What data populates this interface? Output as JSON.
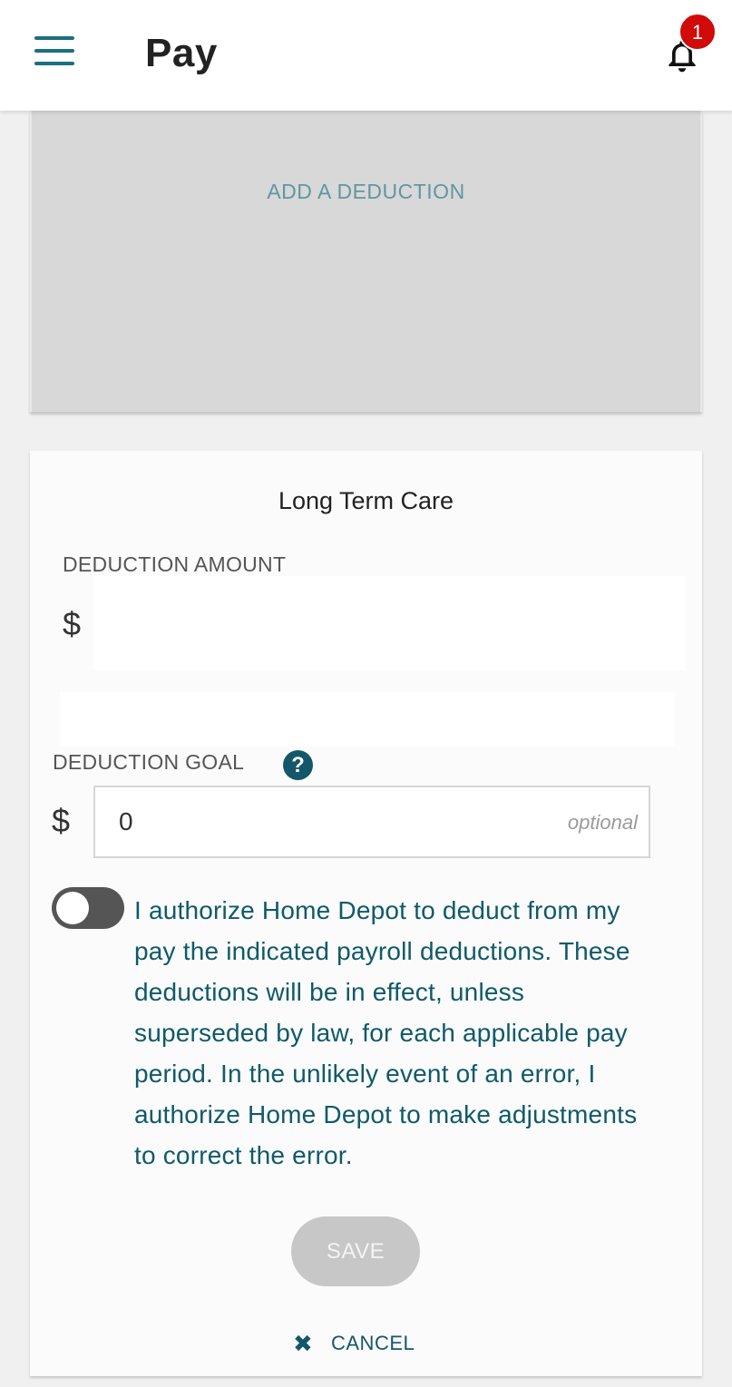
{
  "header": {
    "title": "Pay",
    "menu_icon": "hamburger-menu-icon",
    "bell_icon": "bell-icon",
    "notification_count": "1"
  },
  "add_panel": {
    "label": "ADD A DEDUCTION"
  },
  "form": {
    "title": "Long Term Care",
    "amount_label": "DEDUCTION AMOUNT",
    "amount_currency": "$",
    "amount_value": "",
    "goal_label": "DEDUCTION GOAL",
    "goal_help_icon": "?",
    "goal_currency": "$",
    "goal_value": "0",
    "goal_placeholder": "optional",
    "authorize_toggle_on": false,
    "authorize_text": "I authorize Home Depot to deduct from my pay the indicated payroll deductions. These deductions will be in effect, unless superseded by law, for each applicable pay period. In the unlikely event of an error, I authorize Home Depot to make adjustments to correct the error.",
    "save_label": "SAVE",
    "cancel_icon": "✖",
    "cancel_label": "CANCEL"
  },
  "colors": {
    "accent": "#14576a",
    "badge": "#d10a0a",
    "panel": "#d8d8d8"
  }
}
